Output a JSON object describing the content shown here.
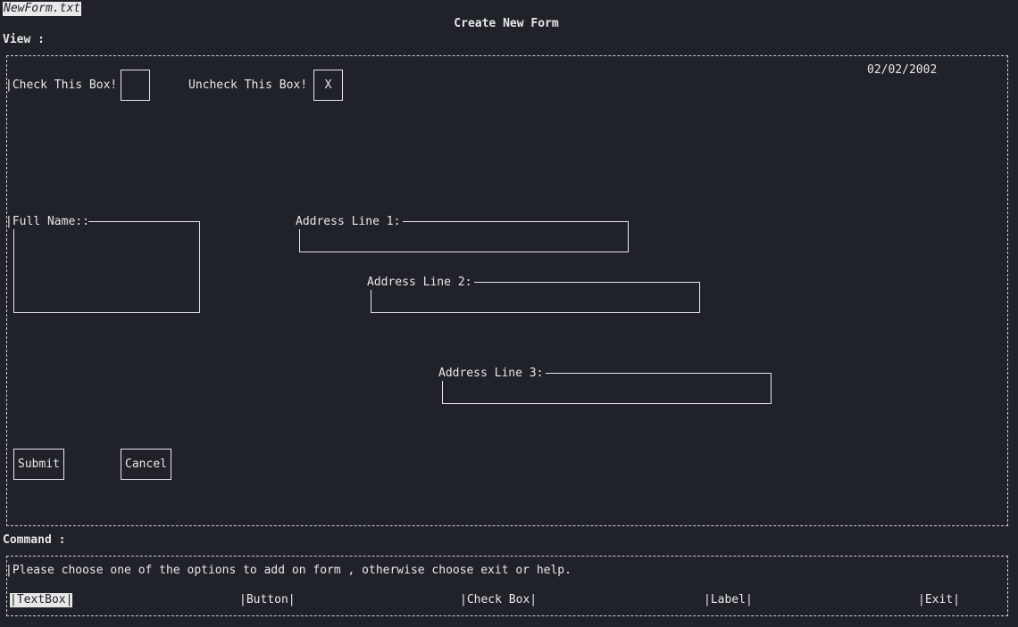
{
  "window": {
    "filename": "NewForm.txt",
    "title": "Create New Form"
  },
  "view": {
    "label": "View :",
    "date": "02/02/2002",
    "check_label": "|Check This Box!",
    "uncheck_label": "Uncheck This Box!",
    "check_state": "",
    "uncheck_state": "X",
    "full_name_label": "|Full Name::",
    "address1_label": "Address Line 1:",
    "address2_label": "Address Line 2:",
    "address3_label": "Address Line 3:",
    "full_name_value": "",
    "address1_value": "",
    "address2_value": "",
    "address3_value": "",
    "submit_label": "Submit",
    "cancel_label": "Cancel"
  },
  "command": {
    "label": "Command :",
    "message": "|Please choose one of the options to add on form , otherwise choose exit or help.",
    "menu": [
      {
        "label": "|TextBox|",
        "selected": true
      },
      {
        "label": "|Button|",
        "selected": false
      },
      {
        "label": "|Check Box|",
        "selected": false
      },
      {
        "label": "|Label|",
        "selected": false
      },
      {
        "label": "|Exit|",
        "selected": false
      }
    ]
  },
  "colors": {
    "background": "#1f2228",
    "foreground": "#e8e8e8"
  }
}
